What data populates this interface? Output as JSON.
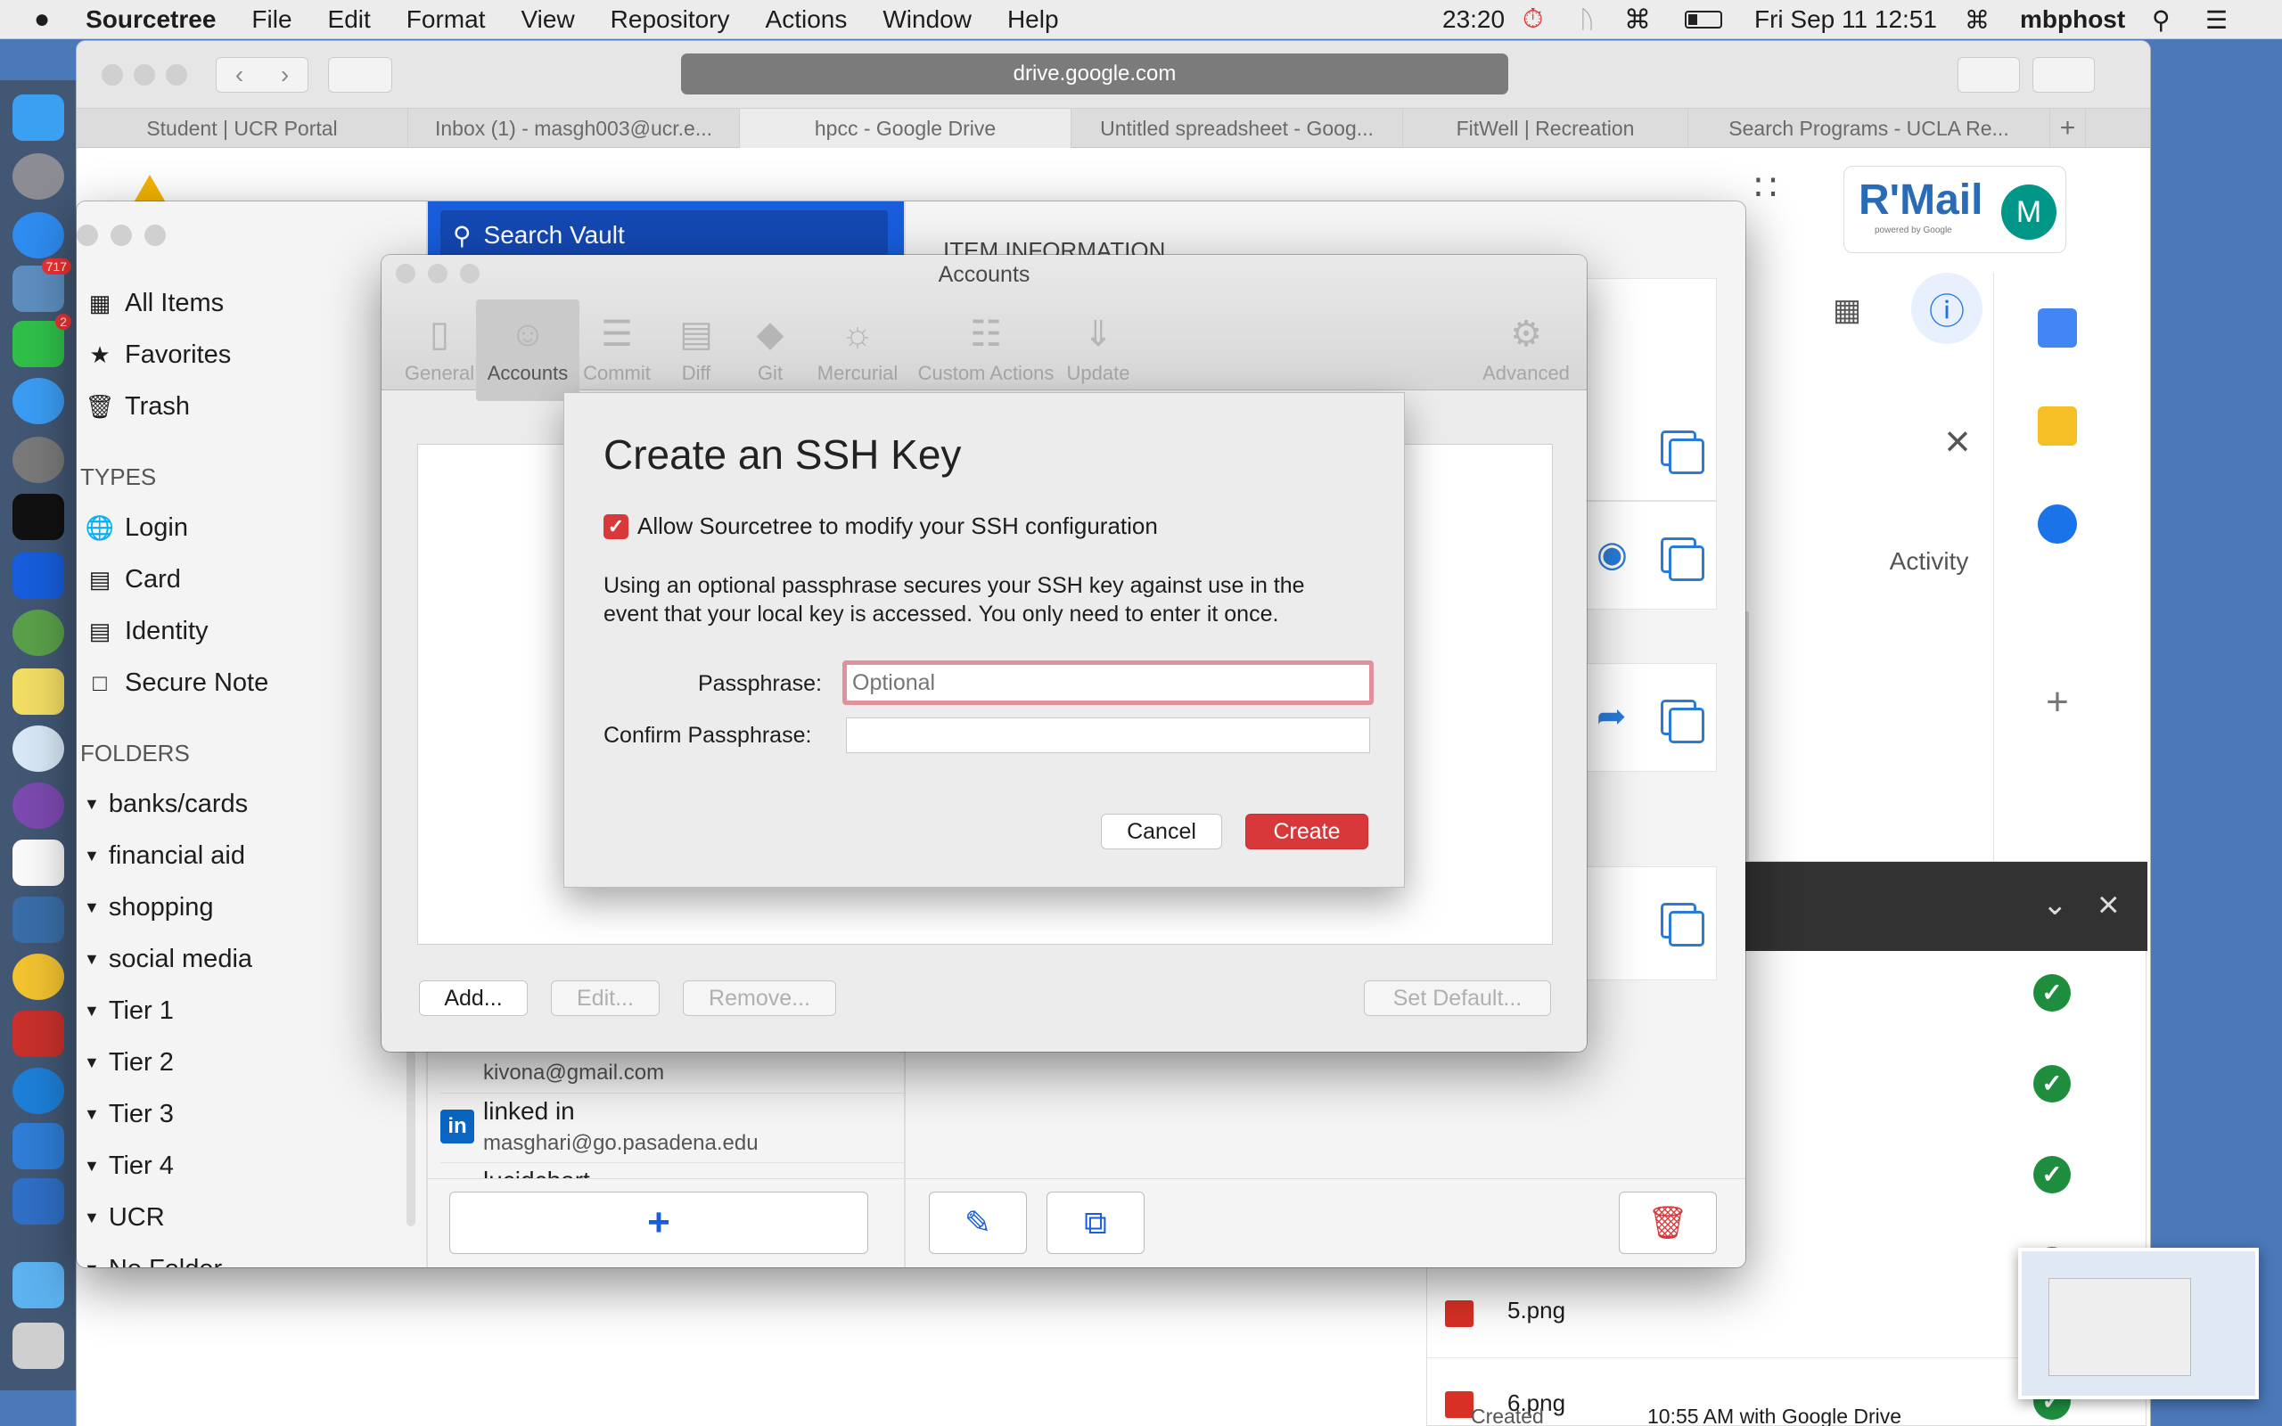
{
  "menubar": {
    "apple": "",
    "app_name": "Sourcetree",
    "menus": [
      "File",
      "Edit",
      "Format",
      "View",
      "Repository",
      "Actions",
      "Window",
      "Help"
    ],
    "clock": "23:20",
    "datetime": "Fri Sep 11  12:51",
    "host": "mbphost"
  },
  "dock": {
    "messages_badge": "717",
    "facetime_badge": "2"
  },
  "browser": {
    "url": "drive.google.com",
    "tabs": [
      "Student | UCR Portal",
      "Inbox (1) - masgh003@ucr.e...",
      "hpcc - Google Drive",
      "Untitled spreadsheet - Goog...",
      "FitWell | Recreation",
      "Search Programs - UCLA Re..."
    ],
    "active_tab_index": 2
  },
  "drive": {
    "rmail_logo": "R'Mail",
    "rmail_sub": "powered by Google",
    "avatar_letter": "M",
    "activity_tab": "Activity",
    "files": [
      "5.png",
      "6.png"
    ],
    "created_label": "Created",
    "created_value": "10:55 AM with Google Drive"
  },
  "bitwarden": {
    "search_placeholder": "Search Vault",
    "item_info_header": "ITEM INFORMATION",
    "nav": {
      "all_items": "All Items",
      "favorites": "Favorites",
      "trash": "Trash"
    },
    "types_header": "TYPES",
    "types": [
      "Login",
      "Card",
      "Identity",
      "Secure Note"
    ],
    "folders_header": "FOLDERS",
    "folders": [
      "banks/cards",
      "financial aid",
      "shopping",
      "social media",
      "Tier 1",
      "Tier 2",
      "Tier 3",
      "Tier 4",
      "UCR",
      "No Folder"
    ],
    "list": [
      {
        "title": "",
        "subtitle": "kivona@gmail.com"
      },
      {
        "title": "linked in",
        "subtitle": "masghari@go.pasadena.edu"
      },
      {
        "title": "lucidchart",
        "subtitle": ""
      }
    ]
  },
  "accounts_window": {
    "title": "Accounts",
    "toolbar": [
      "General",
      "Accounts",
      "Commit",
      "Diff",
      "Git",
      "Mercurial",
      "Custom Actions",
      "Update",
      "Advanced"
    ],
    "selected_tool": "Accounts",
    "buttons": {
      "add": "Add...",
      "edit": "Edit...",
      "remove": "Remove...",
      "set_default": "Set Default..."
    }
  },
  "ssh_dialog": {
    "title": "Create an SSH Key",
    "checkbox_label": "Allow Sourcetree to modify your SSH configuration",
    "checkbox_checked": true,
    "description_line1": "Using an optional passphrase secures your SSH key against use in the",
    "description_line2": "event that your local key is accessed. You only need to enter it once.",
    "passphrase_label": "Passphrase:",
    "passphrase_placeholder": "Optional",
    "passphrase_value": "",
    "confirm_label": "Confirm Passphrase:",
    "confirm_value": "",
    "cancel": "Cancel",
    "create": "Create"
  },
  "colors": {
    "accent_red": "#d9383a",
    "bitwarden_blue": "#175ddc",
    "drive_blue": "#1a73e8",
    "check_green": "#1e8e3e"
  }
}
